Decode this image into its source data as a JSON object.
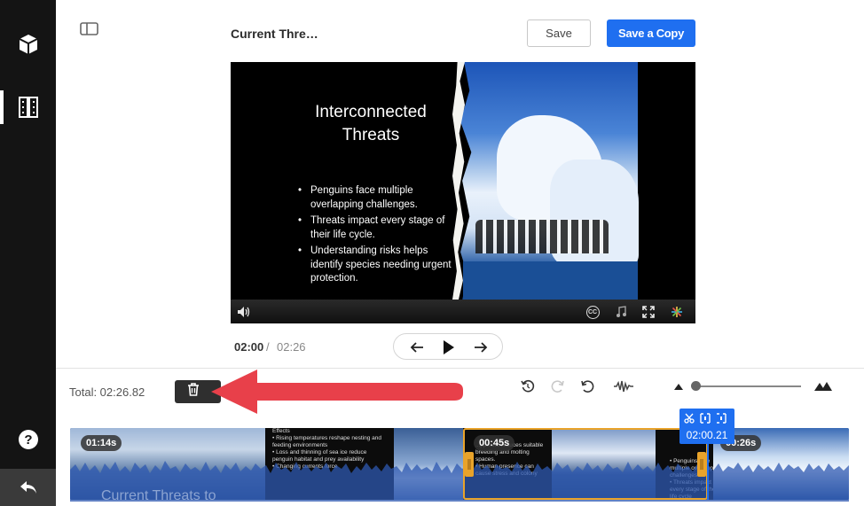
{
  "sidebar": {
    "items": [
      {
        "icon": "cube-icon"
      },
      {
        "icon": "filmstrip-icon",
        "active": true
      }
    ],
    "help_icon": "help-icon",
    "back_icon": "undo-arrow-icon"
  },
  "toolbar": {
    "title": "Current Thre…",
    "save_label": "Save",
    "copy_label": "Save a Copy"
  },
  "slide": {
    "title_line1": "Interconnected",
    "title_line2": "Threats",
    "bullets": [
      "Penguins face multiple overlapping challenges.",
      "Threats impact every stage of their life cycle.",
      "Understanding risks helps identify species needing urgent protection."
    ],
    "cc_label": "CC"
  },
  "playback": {
    "current": "02:00",
    "separator": "/",
    "total": "02:26"
  },
  "timeline": {
    "total_label": "Total: 02:26.82",
    "clips": [
      {
        "badge": "01:14s",
        "text": "Effects\n• Rising temperatures reshape nesting and feeding environments\n• Loss and thinning of sea ice reduce penguin habitat and prey availability\n• Changing currents force",
        "caption": "Current Threats to"
      },
      {
        "badge": "00:45s",
        "text": "...ppment reduces suitable breeding and molting spaces.\n• Human presence can cause stress and colony"
      },
      {
        "badge": "00:26s",
        "text": "• Penguins face multiple overlapping challenges\n• Threats impact every stage of their life cycle"
      }
    ],
    "playhead_time": "02:00.21"
  },
  "colors": {
    "accent": "#1f6ff0",
    "selection": "#e9a32a",
    "sidebar": "#141414",
    "arrow": "#e8404a"
  }
}
